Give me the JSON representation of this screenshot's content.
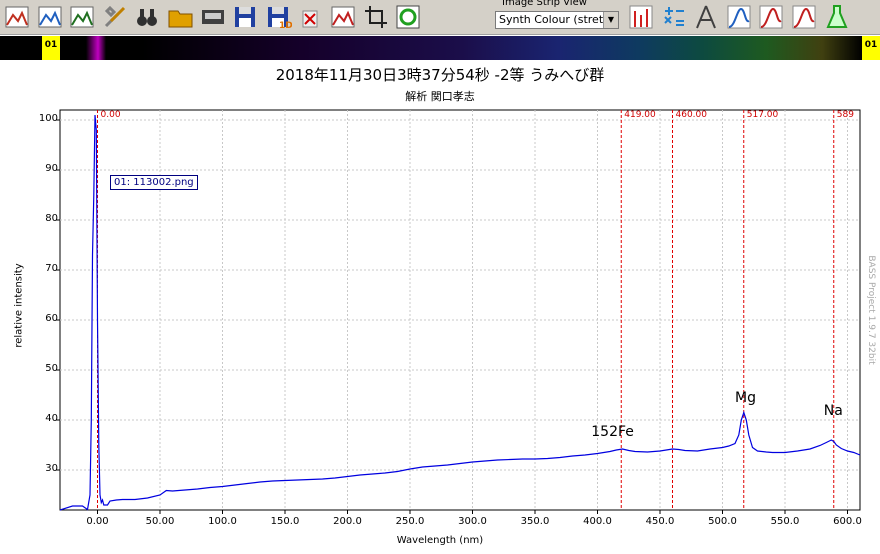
{
  "toolbar": {
    "buttons": [
      {
        "name": "new-profile-icon",
        "color": "#c03020"
      },
      {
        "name": "open-image-icon",
        "color": "#2060c0"
      },
      {
        "name": "save-image-icon",
        "color": "#207020"
      },
      {
        "name": "tools-icon",
        "color": "#808080"
      },
      {
        "name": "binoculars-icon",
        "color": "#303030"
      },
      {
        "name": "open-folder-icon",
        "color": "#e0a000"
      },
      {
        "name": "monitor-icon",
        "color": "#404040"
      },
      {
        "name": "save-disk-icon",
        "color": "#2040a0"
      },
      {
        "name": "save-1d-icon",
        "color": "#2040a0"
      },
      {
        "name": "delete-icon",
        "color": "#d00000"
      },
      {
        "name": "calibrate-icon",
        "color": "#c02020"
      },
      {
        "name": "crop-icon",
        "color": "#202020"
      },
      {
        "name": "refresh-icon",
        "color": "#20a020"
      }
    ],
    "strip_label": "Image Strip View",
    "strip_select": "Synth Colour (stretc",
    "right_buttons": [
      {
        "name": "bar-chart-icon",
        "color": "#d02020"
      },
      {
        "name": "calculator-icon",
        "color": "#2080d0"
      },
      {
        "name": "compass-icon",
        "color": "#404040"
      },
      {
        "name": "reference-icon",
        "color": "#2060c0"
      },
      {
        "name": "curve-icon",
        "color": "#c02020"
      },
      {
        "name": "kelvin-icon",
        "color": "#c02020"
      },
      {
        "name": "flask-icon",
        "color": "#20a020"
      }
    ]
  },
  "strip": {
    "left_badge": "01",
    "right_badge": "01"
  },
  "chart": {
    "title": "2018年11月30日3時37分54秒  -2等  うみへび群",
    "subtitle": "解析  関口孝志",
    "watermark": "BASS Project 1.9.7  32bit",
    "file_label": "01: 113002.png"
  },
  "chart_data": {
    "type": "line",
    "xlabel": "Wavelength (nm)",
    "ylabel": "relative intensity",
    "xlim": [
      -30,
      610
    ],
    "ylim": [
      22,
      102
    ],
    "xticks": [
      "0.00",
      "50.00",
      "100.0",
      "150.0",
      "200.0",
      "250.0",
      "300.0",
      "350.0",
      "400.0",
      "450.0",
      "500.0",
      "550.0",
      "600.0"
    ],
    "yticks": [
      "30",
      "40",
      "50",
      "60",
      "70",
      "80",
      "90",
      "100"
    ],
    "grid": true,
    "line_color": "#0000e0",
    "marker_color": "#e00000",
    "markers": [
      {
        "x": 0,
        "label": "0.00"
      },
      {
        "x": 419,
        "label": "419.00"
      },
      {
        "x": 460,
        "label": "460.00"
      },
      {
        "x": 517,
        "label": "517.00"
      },
      {
        "x": 589,
        "label": "589"
      }
    ],
    "annotations": [
      {
        "text": "152Fe",
        "x": 395,
        "y": 37.5
      },
      {
        "text": "Mg",
        "x": 510,
        "y": 44.2
      },
      {
        "text": "Na",
        "x": 581,
        "y": 41.7
      }
    ],
    "series": [
      {
        "x": [
          -30,
          -20,
          -12,
          -8,
          -6,
          -5,
          -4,
          -3,
          -2,
          -1,
          0,
          1,
          2,
          3,
          4,
          5,
          6,
          8,
          10,
          15,
          20,
          30,
          40,
          50,
          55,
          60,
          70,
          80,
          90,
          100,
          110,
          120,
          130,
          140,
          150,
          160,
          170,
          180,
          190,
          200,
          210,
          220,
          230,
          240,
          250,
          260,
          270,
          280,
          290,
          300,
          310,
          320,
          330,
          340,
          350,
          360,
          370,
          380,
          390,
          400,
          410,
          415,
          420,
          425,
          430,
          440,
          450,
          455,
          460,
          465,
          470,
          480,
          490,
          500,
          505,
          510,
          513,
          515,
          517,
          519,
          521,
          524,
          528,
          535,
          540,
          550,
          560,
          570,
          578,
          583,
          587,
          589,
          591,
          595,
          600,
          605,
          610
        ],
        "y": [
          22.0,
          22.8,
          22.8,
          22.1,
          25.0,
          40.0,
          73.0,
          85.0,
          101.0,
          98.0,
          60.0,
          35.0,
          25.0,
          23.5,
          24.0,
          23.0,
          23.0,
          23.0,
          23.8,
          24.0,
          24.1,
          24.1,
          24.4,
          25.0,
          25.9,
          25.8,
          26.0,
          26.2,
          26.5,
          26.7,
          27.0,
          27.3,
          27.6,
          27.8,
          27.9,
          28.0,
          28.1,
          28.2,
          28.4,
          28.7,
          29.0,
          29.2,
          29.4,
          29.7,
          30.2,
          30.6,
          30.8,
          31.0,
          31.3,
          31.6,
          31.8,
          32.0,
          32.1,
          32.2,
          32.2,
          32.3,
          32.5,
          32.8,
          33.0,
          33.3,
          33.7,
          34.0,
          34.2,
          33.9,
          33.7,
          33.6,
          33.8,
          34.0,
          34.2,
          34.1,
          33.9,
          33.8,
          34.2,
          34.5,
          34.8,
          35.3,
          37.0,
          40.0,
          41.5,
          40.0,
          37.0,
          34.5,
          33.8,
          33.6,
          33.5,
          33.5,
          33.8,
          34.2,
          34.9,
          35.5,
          36.0,
          35.7,
          35.0,
          34.3,
          33.8,
          33.5,
          33.0
        ]
      }
    ]
  }
}
